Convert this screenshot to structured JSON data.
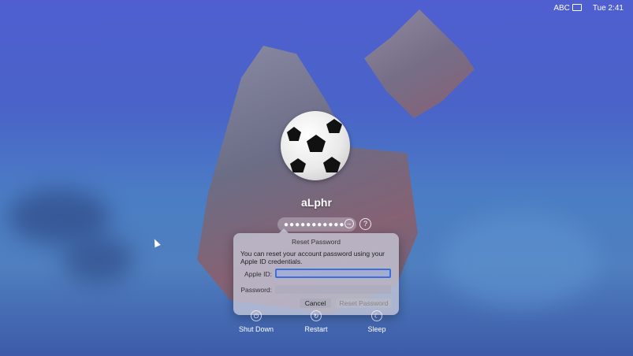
{
  "menubar": {
    "input_source": "ABC",
    "clock": "Tue 2:41"
  },
  "login": {
    "username": "aLphr",
    "password_mask": "●●●●●●●●●●●",
    "submit_icon": "arrow-right-circle-icon",
    "help_label": "?"
  },
  "reset_dialog": {
    "title": "Reset Password",
    "message": "You can reset your account password using your Apple ID credentials.",
    "apple_id_label": "Apple ID:",
    "apple_id_value": "",
    "password_label": "Password:",
    "password_value": "",
    "cancel_label": "Cancel",
    "reset_label": "Reset Password"
  },
  "actions": [
    {
      "label": "Shut Down",
      "icon": "power-icon"
    },
    {
      "label": "Restart",
      "icon": "restart-icon"
    },
    {
      "label": "Sleep",
      "icon": "sleep-icon"
    }
  ]
}
